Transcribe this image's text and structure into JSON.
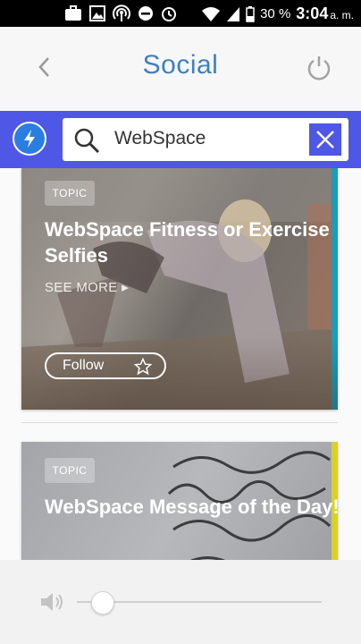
{
  "status_bar": {
    "battery_percent": "30 %",
    "time": "3:04",
    "ampm": "a. m.",
    "icons": [
      "briefcase-icon",
      "image-icon",
      "hotspot-icon",
      "dnd-icon",
      "alarm-icon",
      "wifi-icon",
      "battery-icon"
    ]
  },
  "header": {
    "title": "Social",
    "back_icon": "chevron-left-icon",
    "power_icon": "power-icon"
  },
  "search": {
    "value": "WebSpace",
    "icon": "search-icon",
    "clear_icon": "close-icon",
    "accent": "#4f57e6"
  },
  "cards": [
    {
      "badge": "TOPIC",
      "title": "WebSpace Fitness or Exercise Selfies",
      "see_more": "SEE MORE",
      "follow_label": "Follow",
      "edge_color": "#1c9cb8"
    },
    {
      "badge": "TOPIC",
      "title": "WebSpace Message of the Day!",
      "edge_color": "#d8d321"
    }
  ],
  "player": {
    "volume_level": 0.1
  }
}
